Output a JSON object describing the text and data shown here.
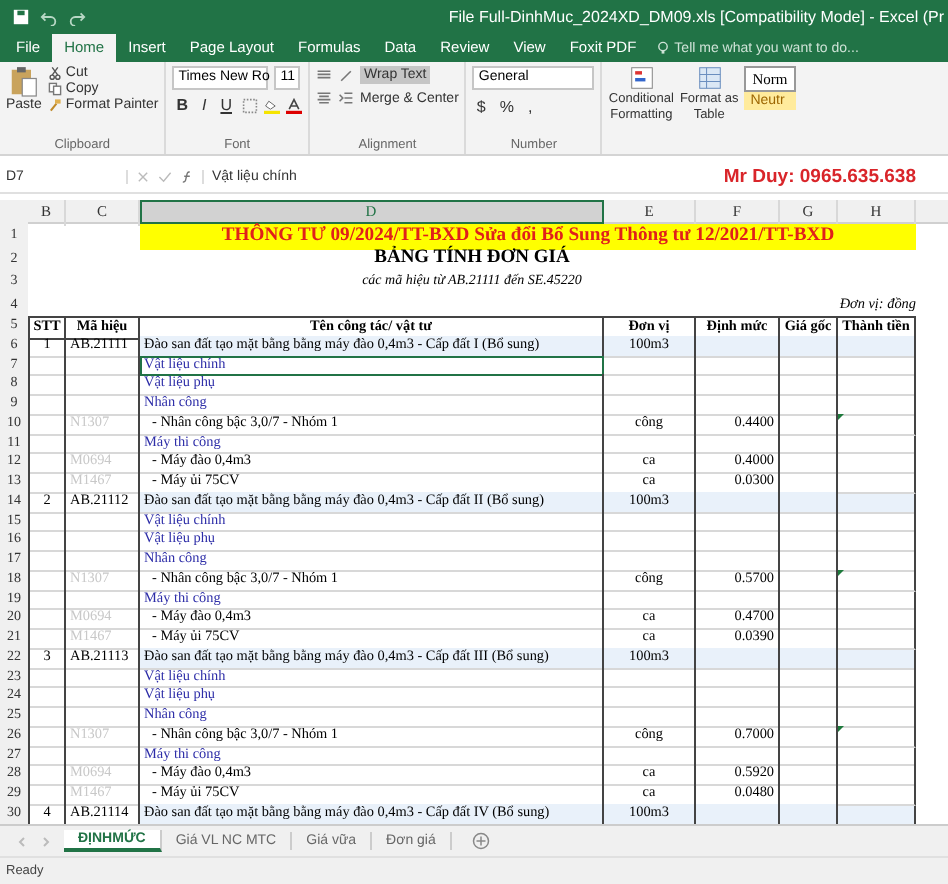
{
  "window": {
    "title": "File Full-DinhMuc_2024XD_DM09.xls  [Compatibility Mode]  -  Excel (Pr"
  },
  "ribbon_tabs": [
    {
      "label": "File",
      "selected": false
    },
    {
      "label": "Home",
      "selected": true
    },
    {
      "label": "Insert",
      "selected": false
    },
    {
      "label": "Page Layout",
      "selected": false
    },
    {
      "label": "Formulas",
      "selected": false
    },
    {
      "label": "Data",
      "selected": false
    },
    {
      "label": "Review",
      "selected": false
    },
    {
      "label": "View",
      "selected": false
    },
    {
      "label": "Foxit PDF",
      "selected": false
    }
  ],
  "tell_me": {
    "placeholder": "Tell me what you want to do..."
  },
  "clipboard": {
    "paste": "Paste",
    "cut": "Cut",
    "copy": "Copy",
    "format_painter": "Format Painter",
    "group": "Clipboard"
  },
  "font": {
    "name": "Times New Ro",
    "size": "11",
    "bold": "B",
    "italic": "I",
    "underline": "U",
    "group": "Font"
  },
  "alignment": {
    "wrap_text": {
      "label": "Wrap Text",
      "on": true
    },
    "merge": "Merge & Center",
    "group": "Alignment"
  },
  "number": {
    "format": "General",
    "currency": "$",
    "percent": "%",
    "comma": ",",
    "group": "Number"
  },
  "styles": {
    "conditional": [
      "Conditional",
      "Formatting"
    ],
    "format_table": [
      "Format as",
      "Table"
    ],
    "normal": "Norm",
    "neutral": "Neutr"
  },
  "formula_bar": {
    "name_box": "D7",
    "value": "Vật liệu chính",
    "banner": "Mr Duy: 0965.635.638"
  },
  "columns": [
    {
      "label": "B",
      "selected": false
    },
    {
      "label": "C",
      "selected": false
    },
    {
      "label": "D",
      "selected": true
    },
    {
      "label": "E",
      "selected": false
    },
    {
      "label": "F",
      "selected": false
    },
    {
      "label": "G",
      "selected": false
    },
    {
      "label": "H",
      "selected": false
    }
  ],
  "sheet": {
    "row_numbers": [
      "1",
      "2",
      "3",
      "4",
      "5"
    ],
    "title": "THÔNG TƯ 09/2024/TT-BXD Sửa đổi Bổ Sung Thông tư 12/2021/TT-BXD",
    "heading": "BẢNG TÍNH ĐƠN GIÁ",
    "subheading": "các mã hiệu từ AB.21111 đến SE.45220",
    "unit_note": "Đơn vị: đồng",
    "headers": [
      "STT",
      "Mã hiệu",
      "Tên công tác/ vật tư",
      "Đơn vị",
      "Định mức",
      "Giá gốc",
      "Thành tiền"
    ]
  },
  "rows": [
    {
      "num": "6",
      "kind": "item",
      "stt": "1",
      "code": "AB.21111",
      "name": "Đào san đất tạo mặt bằng bằng máy đào 0,4m3 - Cấp đất I (Bổ sung)",
      "unit": "100m3",
      "selected": false
    },
    {
      "num": "7",
      "kind": "group",
      "name": "Vật liệu chính",
      "selected": true
    },
    {
      "num": "8",
      "kind": "group",
      "name": "Vật liệu phụ",
      "selected": false
    },
    {
      "num": "9",
      "kind": "group",
      "name": "Nhân công",
      "selected": false
    },
    {
      "num": "10",
      "kind": "detail",
      "code": "N1307",
      "name": "- Nhân công bậc 3,0/7 - Nhóm 1",
      "unit": "công",
      "norm": "0.4400",
      "flag": true,
      "selected": false
    },
    {
      "num": "11",
      "kind": "group",
      "name": "Máy thi công",
      "selected": false
    },
    {
      "num": "12",
      "kind": "detail",
      "code": "M0694",
      "name": "- Máy đào 0,4m3",
      "unit": "ca",
      "norm": "0.4000",
      "flag": false,
      "selected": false
    },
    {
      "num": "13",
      "kind": "detail",
      "code": "M1467",
      "name": "- Máy ủi 75CV",
      "unit": "ca",
      "norm": "0.0300",
      "flag": false,
      "selected": false
    },
    {
      "num": "14",
      "kind": "item",
      "stt": "2",
      "code": "AB.21112",
      "name": "Đào san đất tạo mặt bằng bằng máy đào 0,4m3 - Cấp đất II (Bổ sung)",
      "unit": "100m3",
      "selected": false
    },
    {
      "num": "15",
      "kind": "group",
      "name": "Vật liệu chính",
      "selected": false
    },
    {
      "num": "16",
      "kind": "group",
      "name": "Vật liệu phụ",
      "selected": false
    },
    {
      "num": "17",
      "kind": "group",
      "name": "Nhân công",
      "selected": false
    },
    {
      "num": "18",
      "kind": "detail",
      "code": "N1307",
      "name": "- Nhân công bậc 3,0/7 - Nhóm 1",
      "unit": "công",
      "norm": "0.5700",
      "flag": true,
      "selected": false
    },
    {
      "num": "19",
      "kind": "group",
      "name": "Máy thi công",
      "selected": false
    },
    {
      "num": "20",
      "kind": "detail",
      "code": "M0694",
      "name": "- Máy đào 0,4m3",
      "unit": "ca",
      "norm": "0.4700",
      "flag": false,
      "selected": false
    },
    {
      "num": "21",
      "kind": "detail",
      "code": "M1467",
      "name": "- Máy ủi 75CV",
      "unit": "ca",
      "norm": "0.0390",
      "flag": false,
      "selected": false
    },
    {
      "num": "22",
      "kind": "item",
      "stt": "3",
      "code": "AB.21113",
      "name": "Đào san đất tạo mặt bằng bằng máy đào 0,4m3 - Cấp đất III (Bổ sung)",
      "unit": "100m3",
      "selected": false
    },
    {
      "num": "23",
      "kind": "group",
      "name": "Vật liệu chính",
      "selected": false
    },
    {
      "num": "24",
      "kind": "group",
      "name": "Vật liệu phụ",
      "selected": false
    },
    {
      "num": "25",
      "kind": "group",
      "name": "Nhân công",
      "selected": false
    },
    {
      "num": "26",
      "kind": "detail",
      "code": "N1307",
      "name": "- Nhân công bậc 3,0/7 - Nhóm 1",
      "unit": "công",
      "norm": "0.7000",
      "flag": true,
      "selected": false
    },
    {
      "num": "27",
      "kind": "group",
      "name": "Máy thi công",
      "selected": false
    },
    {
      "num": "28",
      "kind": "detail",
      "code": "M0694",
      "name": "- Máy đào 0,4m3",
      "unit": "ca",
      "norm": "0.5920",
      "flag": false,
      "selected": false
    },
    {
      "num": "29",
      "kind": "detail",
      "code": "M1467",
      "name": "- Máy ủi 75CV",
      "unit": "ca",
      "norm": "0.0480",
      "flag": false,
      "selected": false
    },
    {
      "num": "30",
      "kind": "item",
      "stt": "4",
      "code": "AB.21114",
      "name": "Đào san đất tạo mặt bằng bằng máy đào 0,4m3 - Cấp đất IV (Bổ sung)",
      "unit": "100m3",
      "selected": false
    }
  ],
  "sheet_tabs": [
    {
      "label": "ĐỊNHMỨC",
      "selected": true
    },
    {
      "label": "Giá VL NC MTC",
      "selected": false
    },
    {
      "label": "Giá vữa",
      "selected": false
    },
    {
      "label": "Đơn giá",
      "selected": false
    }
  ],
  "status_bar": {
    "text": "Ready"
  }
}
